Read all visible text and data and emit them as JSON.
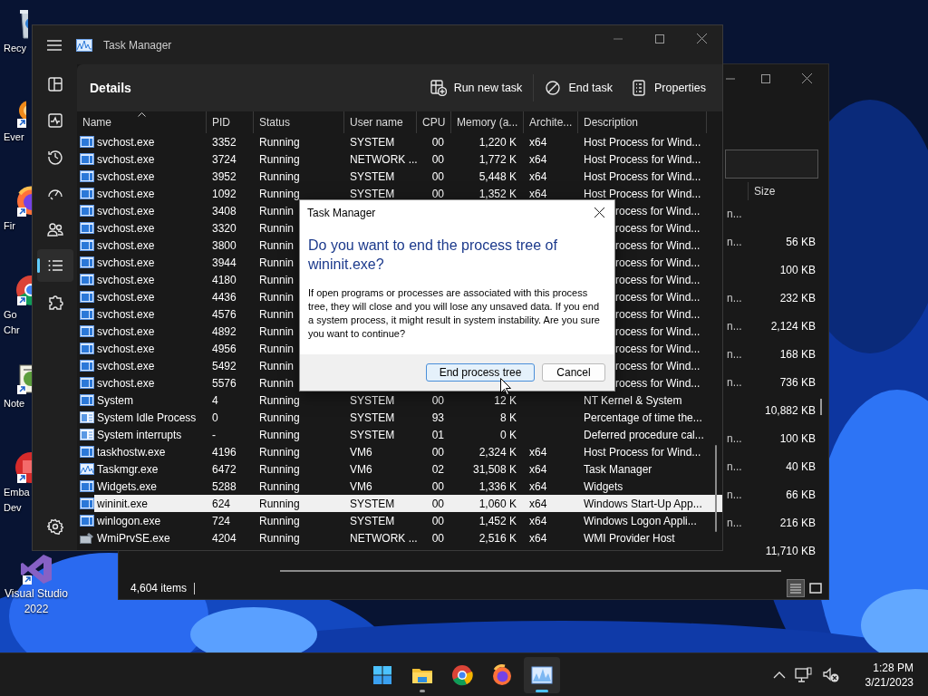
{
  "desktop_icons": [
    {
      "lines": [
        "Recy"
      ],
      "kind": "recycle",
      "shortcut": false
    },
    {
      "lines": [
        "Ever"
      ],
      "kind": "everything",
      "shortcut": true
    },
    {
      "lines": [
        "Fir"
      ],
      "kind": "firefox",
      "shortcut": true
    },
    {
      "lines": [
        "Go",
        "Chr"
      ],
      "kind": "chrome",
      "shortcut": true
    },
    {
      "lines": [
        "Note"
      ],
      "kind": "notepad",
      "shortcut": true
    },
    {
      "lines": [
        "Emba",
        "Dev"
      ],
      "kind": "embarcadero",
      "shortcut": true
    },
    {
      "lines": [
        "Visual Studio",
        "2022"
      ],
      "kind": "visualstudio",
      "shortcut": true
    }
  ],
  "explorer": {
    "column": "Size",
    "status": "4,604 items",
    "rows": [
      {
        "type": "n..."
      },
      {
        "type": "n...",
        "size": "56 KB"
      },
      {
        "size": "100 KB"
      },
      {
        "type": "n...",
        "size": "232 KB"
      },
      {
        "type": "n...",
        "size": "2,124 KB"
      },
      {
        "type": "n...",
        "size": "168 KB"
      },
      {
        "type": "n...",
        "size": "736 KB"
      },
      {
        "size": "10,882 KB"
      },
      {
        "type": "n...",
        "size": "100 KB"
      },
      {
        "type": "n...",
        "size": "40 KB"
      },
      {
        "type": "n...",
        "size": "66 KB"
      },
      {
        "type": "n...",
        "size": "216 KB"
      },
      {
        "size": "11,710 KB"
      }
    ]
  },
  "task_manager": {
    "title": "Task Manager",
    "page_title": "Details",
    "nav": [
      {
        "kind": "processes",
        "selected": false
      },
      {
        "kind": "performance",
        "selected": false
      },
      {
        "kind": "history",
        "selected": false
      },
      {
        "kind": "startup",
        "selected": false
      },
      {
        "kind": "users",
        "selected": false
      },
      {
        "kind": "details",
        "selected": true
      },
      {
        "kind": "services",
        "selected": false
      }
    ],
    "actions": [
      {
        "label": "Run new task",
        "kind": "run"
      },
      {
        "label": "End task",
        "kind": "end"
      },
      {
        "label": "Properties",
        "kind": "properties"
      }
    ],
    "columns": [
      {
        "label": "Name",
        "sorted": true
      },
      {
        "label": "PID",
        "sorted": false
      },
      {
        "label": "Status",
        "sorted": false
      },
      {
        "label": "User name",
        "sorted": false
      },
      {
        "label": "CPU",
        "sorted": false
      },
      {
        "label": "Memory (a...",
        "sorted": false
      },
      {
        "label": "Archite...",
        "sorted": false
      },
      {
        "label": "Description",
        "sorted": false
      }
    ],
    "rows": [
      {
        "kind": "app",
        "name": "svchost.exe",
        "pid": "3352",
        "status": "Running",
        "user": "SYSTEM",
        "cpu": "00",
        "memory": "1,220 K",
        "arch": "x64",
        "description": "Host Process for Wind...",
        "selected": false
      },
      {
        "kind": "app",
        "name": "svchost.exe",
        "pid": "3724",
        "status": "Running",
        "user": "NETWORK ...",
        "cpu": "00",
        "memory": "1,772 K",
        "arch": "x64",
        "description": "Host Process for Wind...",
        "selected": false
      },
      {
        "kind": "app",
        "name": "svchost.exe",
        "pid": "3952",
        "status": "Running",
        "user": "SYSTEM",
        "cpu": "00",
        "memory": "5,448 K",
        "arch": "x64",
        "description": "Host Process for Wind...",
        "selected": false
      },
      {
        "kind": "app",
        "name": "svchost.exe",
        "pid": "1092",
        "status": "Running",
        "user": "SYSTEM",
        "cpu": "00",
        "memory": "1,352 K",
        "arch": "x64",
        "description": "Host Process for Wind...",
        "selected": false
      },
      {
        "kind": "app",
        "name": "svchost.exe",
        "pid": "3408",
        "status": "Runnin",
        "description": "rocess for Wind...",
        "selected": false
      },
      {
        "kind": "app",
        "name": "svchost.exe",
        "pid": "3320",
        "status": "Runnin",
        "description": "rocess for Wind...",
        "selected": false
      },
      {
        "kind": "app",
        "name": "svchost.exe",
        "pid": "3800",
        "status": "Runnin",
        "description": "rocess for Wind...",
        "selected": false
      },
      {
        "kind": "app",
        "name": "svchost.exe",
        "pid": "3944",
        "status": "Runnin",
        "description": "rocess for Wind...",
        "selected": false
      },
      {
        "kind": "app",
        "name": "svchost.exe",
        "pid": "4180",
        "status": "Runnin",
        "description": "rocess for Wind...",
        "selected": false
      },
      {
        "kind": "app",
        "name": "svchost.exe",
        "pid": "4436",
        "status": "Runnin",
        "description": "rocess for Wind...",
        "selected": false
      },
      {
        "kind": "app",
        "name": "svchost.exe",
        "pid": "4576",
        "status": "Runnin",
        "description": "rocess for Wind...",
        "selected": false
      },
      {
        "kind": "app",
        "name": "svchost.exe",
        "pid": "4892",
        "status": "Runnin",
        "description": "rocess for Wind...",
        "selected": false
      },
      {
        "kind": "app",
        "name": "svchost.exe",
        "pid": "4956",
        "status": "Runnin",
        "description": "rocess for Wind...",
        "selected": false
      },
      {
        "kind": "app",
        "name": "svchost.exe",
        "pid": "5492",
        "status": "Runnin",
        "description": "rocess for Wind...",
        "selected": false
      },
      {
        "kind": "app",
        "name": "svchost.exe",
        "pid": "5576",
        "status": "Runnin",
        "description": "rocess for Wind...",
        "selected": false
      },
      {
        "kind": "app",
        "name": "System",
        "pid": "4",
        "status": "Running",
        "user": "SYSTEM",
        "cpu": "00",
        "memory": "12 K",
        "description": "NT Kernel & System",
        "selected": false
      },
      {
        "kind": "system",
        "name": "System Idle Process",
        "pid": "0",
        "status": "Running",
        "user": "SYSTEM",
        "cpu": "93",
        "memory": "8 K",
        "description": "Percentage of time the...",
        "selected": false
      },
      {
        "kind": "system",
        "name": "System interrupts",
        "pid": "-",
        "status": "Running",
        "user": "SYSTEM",
        "cpu": "01",
        "memory": "0 K",
        "description": "Deferred procedure cal...",
        "selected": false
      },
      {
        "kind": "app",
        "name": "taskhostw.exe",
        "pid": "4196",
        "status": "Running",
        "user": "VM6",
        "cpu": "00",
        "memory": "2,324 K",
        "arch": "x64",
        "description": "Host Process for Wind...",
        "selected": false
      },
      {
        "kind": "chart",
        "name": "Taskmgr.exe",
        "pid": "6472",
        "status": "Running",
        "user": "VM6",
        "cpu": "02",
        "memory": "31,508 K",
        "arch": "x64",
        "description": "Task Manager",
        "selected": false
      },
      {
        "kind": "app",
        "name": "Widgets.exe",
        "pid": "5288",
        "status": "Running",
        "user": "VM6",
        "cpu": "00",
        "memory": "1,336 K",
        "arch": "x64",
        "description": "Widgets",
        "selected": false
      },
      {
        "kind": "app",
        "name": "wininit.exe",
        "pid": "624",
        "status": "Running",
        "user": "SYSTEM",
        "cpu": "00",
        "memory": "1,060 K",
        "arch": "x64",
        "description": "Windows Start-Up App...",
        "selected": true
      },
      {
        "kind": "app",
        "name": "winlogon.exe",
        "pid": "724",
        "status": "Running",
        "user": "SYSTEM",
        "cpu": "00",
        "memory": "1,452 K",
        "arch": "x64",
        "description": "Windows Logon Appli...",
        "selected": false
      },
      {
        "kind": "tool",
        "name": "WmiPrvSE.exe",
        "pid": "4204",
        "status": "Running",
        "user": "NETWORK ...",
        "cpu": "00",
        "memory": "2,516 K",
        "arch": "x64",
        "description": "WMI Provider Host",
        "selected": false
      }
    ]
  },
  "dialog": {
    "title": "Task Manager",
    "heading": "Do you want to end the process tree of wininit.exe?",
    "body": "If open programs or processes are associated with this process tree, they will close and you will lose any unsaved data. If you end a system process, it might result in system instability. Are you sure you want to continue?",
    "buttons": [
      {
        "label": "End process tree",
        "default": true
      },
      {
        "label": "Cancel",
        "default": false
      }
    ]
  },
  "taskbar": {
    "apps": [
      {
        "kind": "start",
        "running": false,
        "active": false
      },
      {
        "kind": "explorer",
        "running": true,
        "active": false
      },
      {
        "kind": "chrome",
        "running": false,
        "active": false
      },
      {
        "kind": "firefox",
        "running": false,
        "active": false
      },
      {
        "kind": "taskmgr",
        "running": true,
        "active": true
      }
    ],
    "time": "1:28 PM",
    "date": "3/21/2023"
  }
}
